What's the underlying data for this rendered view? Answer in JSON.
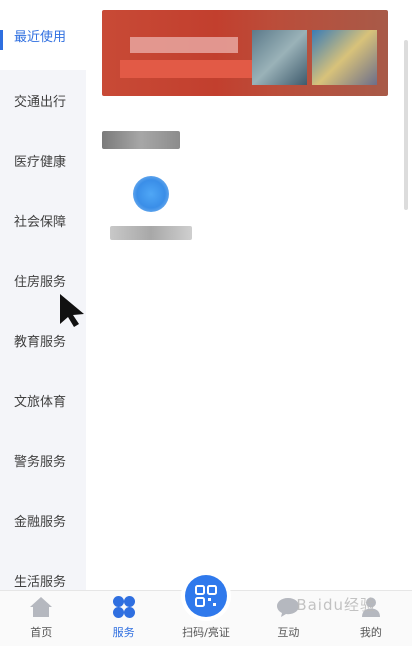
{
  "sidebar": {
    "items": [
      {
        "label": "最近使用",
        "active": true
      },
      {
        "label": "交通出行",
        "active": false
      },
      {
        "label": "医疗健康",
        "active": false
      },
      {
        "label": "社会保障",
        "active": false
      },
      {
        "label": "住房服务",
        "active": false
      },
      {
        "label": "教育服务",
        "active": false
      },
      {
        "label": "文旅体育",
        "active": false
      },
      {
        "label": "警务服务",
        "active": false
      },
      {
        "label": "金融服务",
        "active": false
      },
      {
        "label": "生活服务",
        "active": false
      }
    ]
  },
  "bottom_nav": {
    "items": [
      {
        "label": "首页",
        "icon": "home-icon"
      },
      {
        "label": "服务",
        "icon": "services-icon"
      },
      {
        "label": "扫码/亮证",
        "icon": "qr-scan-icon"
      },
      {
        "label": "互动",
        "icon": "chat-icon"
      },
      {
        "label": "我的",
        "icon": "profile-icon"
      }
    ]
  },
  "watermark": "Baidu经验",
  "colors": {
    "accent": "#2f6fe0",
    "sidebar_bg": "#f4f5f9",
    "banner_red": "#c84a36",
    "scan_blue": "#2f79ec"
  }
}
